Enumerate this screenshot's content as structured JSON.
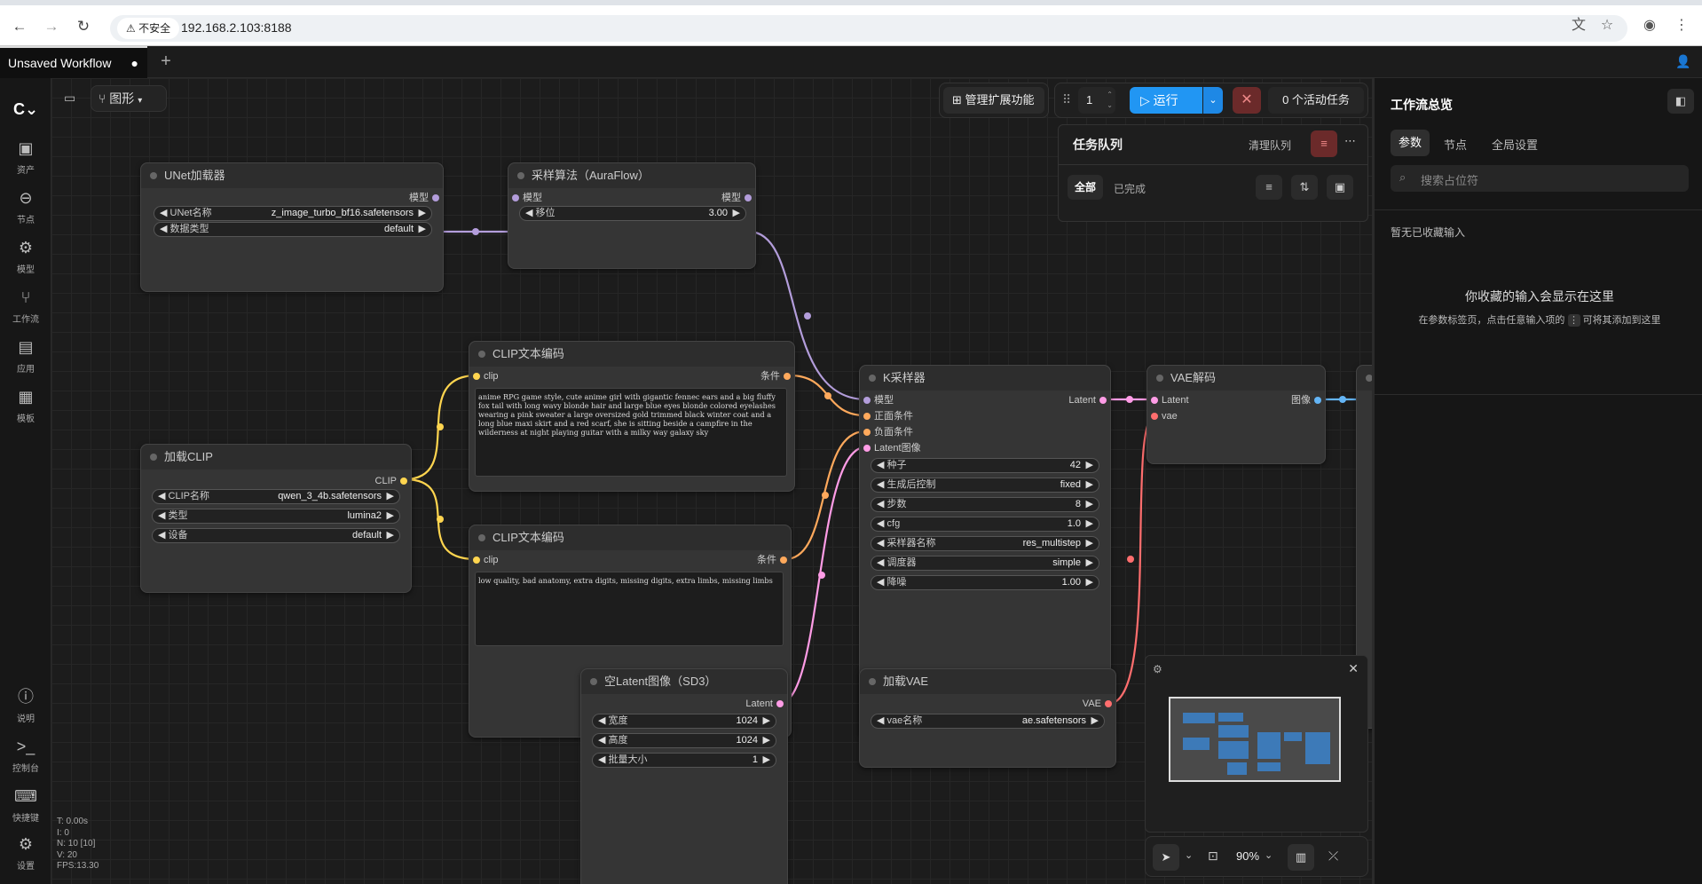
{
  "browser": {
    "security_label": "不安全",
    "url": "192.168.2.103:8188"
  },
  "app_tabs": {
    "workflow_title": "Unsaved Workflow",
    "unsaved_dot": "●",
    "new_tab": "+"
  },
  "sidebar": {
    "items": [
      {
        "label": "资产",
        "icon": "image-icon"
      },
      {
        "label": "节点",
        "icon": "node-icon"
      },
      {
        "label": "模型",
        "icon": "cube-icon"
      },
      {
        "label": "工作流",
        "icon": "workflow-icon"
      },
      {
        "label": "应用",
        "icon": "app-icon"
      },
      {
        "label": "模板",
        "icon": "template-icon"
      },
      {
        "label": "说明",
        "icon": "help-icon"
      },
      {
        "label": "控制台",
        "icon": "terminal-icon"
      },
      {
        "label": "快捷键",
        "icon": "keyboard-icon"
      },
      {
        "label": "设置",
        "icon": "gear-icon"
      }
    ]
  },
  "canvas_toolbar": {
    "view_mode": "图形",
    "manage_extensions": "管理扩展功能",
    "batch_count": "1",
    "run": "运行",
    "active_tasks": "0 个活动任务"
  },
  "queue": {
    "title": "任务队列",
    "clear": "清理队列",
    "tab_all": "全部",
    "tab_done": "已完成"
  },
  "nodes": {
    "unet": {
      "title": "UNet加载器",
      "out": "模型",
      "w1_label": "UNet名称",
      "w1_value": "z_image_turbo_bf16.safetensors",
      "w2_label": "数据类型",
      "w2_value": "default"
    },
    "aura": {
      "title": "采样算法（AuraFlow）",
      "in": "模型",
      "out": "模型",
      "w1_label": "移位",
      "w1_value": "3.00"
    },
    "clip_pos": {
      "title": "CLIP文本编码",
      "in": "clip",
      "out": "条件",
      "text": "anime RPG game style, cute anime girl with gigantic fennec ears and a big fluffy fox tail with long wavy blonde hair and large blue eyes blonde colored eyelashes wearing a pink sweater a large oversized gold trimmed black winter coat and a long blue maxi skirt and a red scarf, she is sitting beside a campfire in the wilderness at night playing guitar with a milky way galaxy sky"
    },
    "clip_neg": {
      "title": "CLIP文本编码",
      "in": "clip",
      "out": "条件",
      "text": "low quality, bad anatomy, extra digits, missing digits, extra limbs, missing limbs"
    },
    "load_clip": {
      "title": "加载CLIP",
      "out": "CLIP",
      "w1_label": "CLIP名称",
      "w1_value": "qwen_3_4b.safetensors",
      "w2_label": "类型",
      "w2_value": "lumina2",
      "w3_label": "设备",
      "w3_value": "default"
    },
    "ksampler": {
      "title": "K采样器",
      "in1": "模型",
      "in2": "正面条件",
      "in3": "负面条件",
      "in4": "Latent图像",
      "out": "Latent",
      "widgets": [
        {
          "label": "种子",
          "value": "42"
        },
        {
          "label": "生成后控制",
          "value": "fixed"
        },
        {
          "label": "步数",
          "value": "8"
        },
        {
          "label": "cfg",
          "value": "1.0"
        },
        {
          "label": "采样器名称",
          "value": "res_multistep"
        },
        {
          "label": "调度器",
          "value": "simple"
        },
        {
          "label": "降噪",
          "value": "1.00"
        }
      ]
    },
    "vae_decode": {
      "title": "VAE解码",
      "in1": "Latent",
      "in2": "vae",
      "out": "图像"
    },
    "empty_latent": {
      "title": "空Latent图像（SD3）",
      "out": "Latent",
      "w1_label": "宽度",
      "w1_value": "1024",
      "w2_label": "高度",
      "w2_value": "1024",
      "w3_label": "批量大小",
      "w3_value": "1"
    },
    "load_vae": {
      "title": "加载VAE",
      "out": "VAE",
      "w1_label": "vae名称",
      "w1_value": "ae.safetensors"
    }
  },
  "stats": {
    "t": "T: 0.00s",
    "i": "I: 0",
    "n": "N: 10 [10]",
    "v": "V: 20",
    "fps": "FPS:13.30"
  },
  "bottom_toolbar": {
    "zoom": "90%"
  },
  "right_panel": {
    "title": "工作流总览",
    "tabs": [
      "参数",
      "节点",
      "全局设置"
    ],
    "search_placeholder": "搜索占位符",
    "no_fav": "暂无已收藏输入",
    "empty_title": "你收藏的输入会显示在这里",
    "empty_hint_a": "在参数标签页，点击任意输入项的",
    "empty_hint_b": "可将其添加到这里"
  },
  "colors": {
    "model_link": "#b39ddb",
    "clip_link": "#ffd54f",
    "cond_link": "#ffa95c",
    "latent_link": "#ff9ce6",
    "vae_link": "#ff6e6e",
    "image_link": "#64b5f6",
    "run_button": "#2196f3"
  }
}
